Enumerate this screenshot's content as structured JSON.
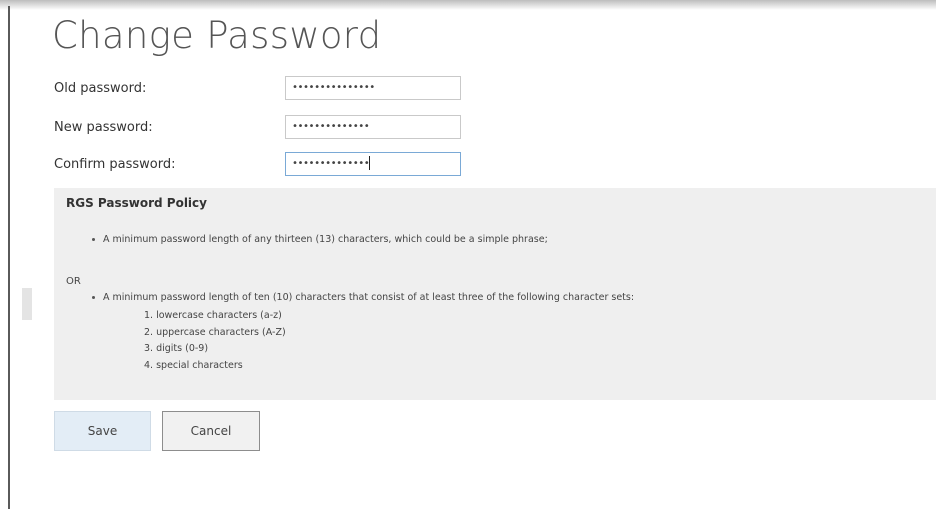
{
  "title": "Change Password",
  "form": {
    "old_label": "Old password:",
    "old_value": "•••••••••••••••",
    "new_label": "New password:",
    "new_value": "••••••••••••••",
    "confirm_label": "Confirm password:",
    "confirm_value": "••••••••••••••"
  },
  "policy": {
    "heading": "RGS Password Policy",
    "rule1": "A minimum password length of any thirteen (13) characters, which could be a simple phrase;",
    "or": "OR",
    "rule2": "A minimum password length of ten (10) characters that consist of at least three of the following character sets:",
    "sets": [
      "1.  lowercase characters (a-z)",
      "2.  uppercase characters (A-Z)",
      "3.  digits (0-9)",
      "4.  special characters"
    ]
  },
  "buttons": {
    "save": "Save",
    "cancel": "Cancel"
  }
}
